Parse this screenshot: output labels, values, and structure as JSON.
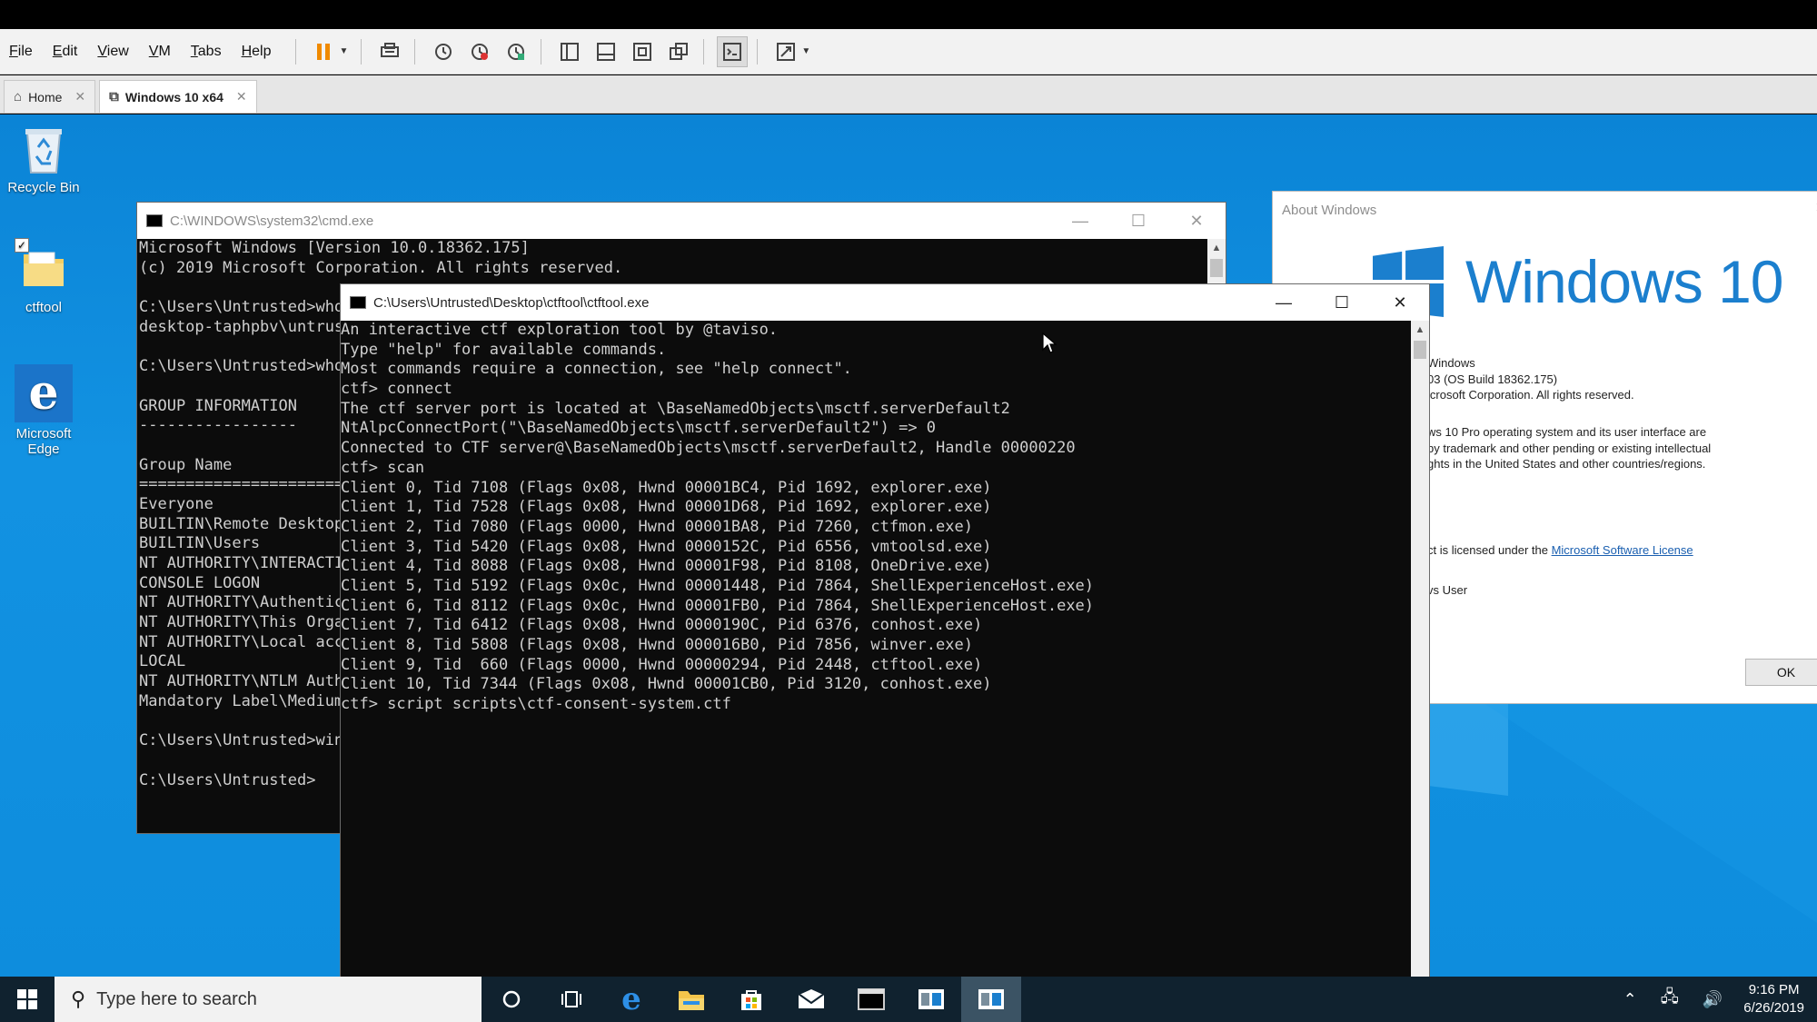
{
  "vmware": {
    "menu": [
      "File",
      "Edit",
      "View",
      "VM",
      "Tabs",
      "Help"
    ],
    "tabs": [
      {
        "label": "Home",
        "icon": "home-icon"
      },
      {
        "label": "Windows 10 x64",
        "icon": "vm-icon"
      }
    ]
  },
  "desktop_icons": [
    {
      "label": "Recycle Bin",
      "icon": "recycle-bin-icon"
    },
    {
      "label": "ctftool",
      "icon": "folder-icon"
    },
    {
      "label": "Microsoft Edge",
      "icon": "edge-icon"
    }
  ],
  "cmd_window": {
    "title": "C:\\WINDOWS\\system32\\cmd.exe",
    "lines": [
      "Microsoft Windows [Version 10.0.18362.175]",
      "(c) 2019 Microsoft Corporation. All rights reserved.",
      "",
      "C:\\Users\\Untrusted>whoa",
      "desktop-taphpbv\\untrust",
      "",
      "C:\\Users\\Untrusted>whoa",
      "",
      "GROUP INFORMATION",
      "-----------------",
      "",
      "Group Name",
      "======================",
      "Everyone",
      "BUILTIN\\Remote Desktop",
      "BUILTIN\\Users",
      "NT AUTHORITY\\INTERACTIV",
      "CONSOLE LOGON",
      "NT AUTHORITY\\Authentica",
      "NT AUTHORITY\\This Organ",
      "NT AUTHORITY\\Local acco",
      "LOCAL",
      "NT AUTHORITY\\NTLM Authe",
      "Mandatory Label\\Medium",
      "",
      "C:\\Users\\Untrusted>winv",
      "",
      "C:\\Users\\Untrusted>"
    ]
  },
  "ctftool_window": {
    "title": "C:\\Users\\Untrusted\\Desktop\\ctftool\\ctftool.exe",
    "lines": [
      "An interactive ctf exploration tool by @taviso.",
      "Type \"help\" for available commands.",
      "Most commands require a connection, see \"help connect\".",
      "ctf> connect",
      "The ctf server port is located at \\BaseNamedObjects\\msctf.serverDefault2",
      "NtAlpcConnectPort(\"\\BaseNamedObjects\\msctf.serverDefault2\") => 0",
      "Connected to CTF server@\\BaseNamedObjects\\msctf.serverDefault2, Handle 00000220",
      "ctf> scan",
      "Client 0, Tid 7108 (Flags 0x08, Hwnd 00001BC4, Pid 1692, explorer.exe)",
      "Client 1, Tid 7528 (Flags 0x08, Hwnd 00001D68, Pid 1692, explorer.exe)",
      "Client 2, Tid 7080 (Flags 0000, Hwnd 00001BA8, Pid 7260, ctfmon.exe)",
      "Client 3, Tid 5420 (Flags 0x08, Hwnd 0000152C, Pid 6556, vmtoolsd.exe)",
      "Client 4, Tid 8088 (Flags 0x08, Hwnd 00001F98, Pid 8108, OneDrive.exe)",
      "Client 5, Tid 5192 (Flags 0x0c, Hwnd 00001448, Pid 7864, ShellExperienceHost.exe)",
      "Client 6, Tid 8112 (Flags 0x0c, Hwnd 00001FB0, Pid 7864, ShellExperienceHost.exe)",
      "Client 7, Tid 6412 (Flags 0x08, Hwnd 0000190C, Pid 6376, conhost.exe)",
      "Client 8, Tid 5808 (Flags 0x08, Hwnd 000016B0, Pid 7856, winver.exe)",
      "Client 9, Tid  660 (Flags 0000, Hwnd 00000294, Pid 2448, ctftool.exe)",
      "Client 10, Tid 7344 (Flags 0x08, Hwnd 00001CB0, Pid 3120, conhost.exe)",
      "ctf> script scripts\\ctf-consent-system.ctf"
    ]
  },
  "about_window": {
    "title": "About Windows",
    "logo_text": "Windows 10",
    "info_lines": [
      "Windows",
      "03 (OS Build 18362.175)",
      "icrosoft Corporation. All rights reserved."
    ],
    "legal_lines": [
      "ws 10 Pro operating system and its user interface are",
      "by trademark and other pending or existing intellectual",
      "ghts in the United States and other countries/regions."
    ],
    "license_prefix": "ct is licensed under the ",
    "license_link": "Microsoft Software License",
    "user_line": "vs User",
    "ok_label": "OK"
  },
  "taskbar": {
    "search_placeholder": "Type here to search",
    "apps": [
      "cortana-icon",
      "task-view-icon",
      "edge-icon",
      "file-explorer-icon",
      "store-icon",
      "mail-icon",
      "cmd-icon",
      "winver-icon",
      "ctftool-icon"
    ],
    "time": "9:16 PM",
    "date": "6/26/2019"
  },
  "colors": {
    "desktop": "#0e8ddd",
    "console_bg": "#0c0c0c",
    "console_text": "#cfcfcf",
    "taskbar": "#10222f",
    "win10_blue": "#1b7fce"
  }
}
